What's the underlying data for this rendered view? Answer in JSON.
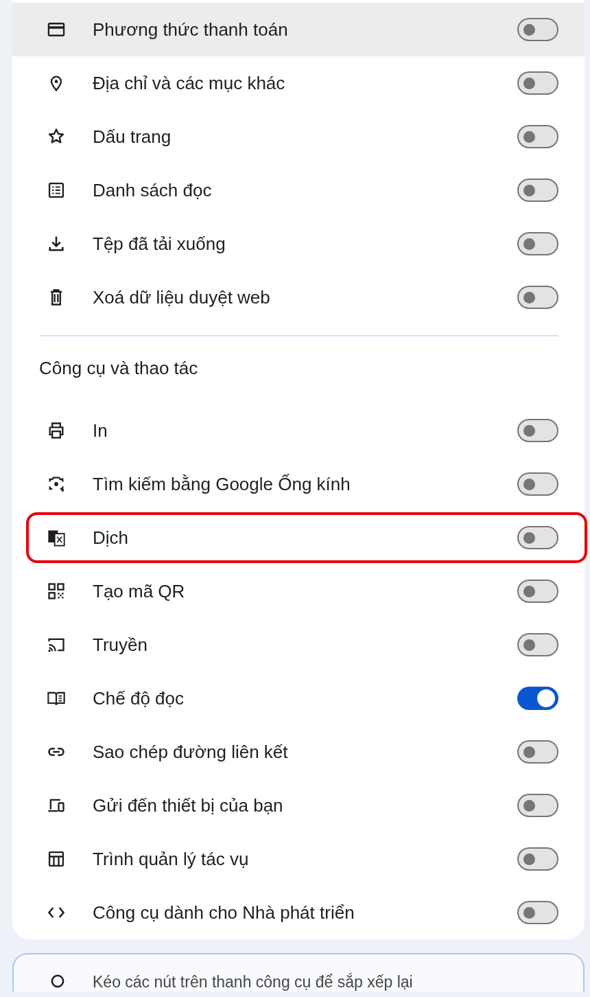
{
  "sections": [
    {
      "items": [
        {
          "label": "Phương thức thanh toán",
          "on": false,
          "hovered": true,
          "highlighted": false
        },
        {
          "label": "Địa chỉ và các mục khác",
          "on": false,
          "hovered": false,
          "highlighted": false
        },
        {
          "label": "Dấu trang",
          "on": false,
          "hovered": false,
          "highlighted": false
        },
        {
          "label": "Danh sách đọc",
          "on": false,
          "hovered": false,
          "highlighted": false
        },
        {
          "label": "Tệp đã tải xuống",
          "on": false,
          "hovered": false,
          "highlighted": false
        },
        {
          "label": "Xoá dữ liệu duyệt web",
          "on": false,
          "hovered": false,
          "highlighted": false
        }
      ]
    },
    {
      "header": "Công cụ và thao tác",
      "items": [
        {
          "label": "In",
          "on": false,
          "hovered": false,
          "highlighted": false
        },
        {
          "label": "Tìm kiếm bằng Google Ống kính",
          "on": false,
          "hovered": false,
          "highlighted": false
        },
        {
          "label": "Dịch",
          "on": false,
          "hovered": false,
          "highlighted": true
        },
        {
          "label": "Tạo mã QR",
          "on": false,
          "hovered": false,
          "highlighted": false
        },
        {
          "label": "Truyền",
          "on": false,
          "hovered": false,
          "highlighted": false
        },
        {
          "label": "Chế độ đọc",
          "on": true,
          "hovered": false,
          "highlighted": false
        },
        {
          "label": "Sao chép đường liên kết",
          "on": false,
          "hovered": false,
          "highlighted": false
        },
        {
          "label": "Gửi đến thiết bị của bạn",
          "on": false,
          "hovered": false,
          "highlighted": false
        },
        {
          "label": "Trình quản lý tác vụ",
          "on": false,
          "hovered": false,
          "highlighted": false
        },
        {
          "label": "Công cụ dành cho Nhà phát triển",
          "on": false,
          "hovered": false,
          "highlighted": false
        }
      ]
    }
  ],
  "hint": {
    "text": "Kéo các nút trên thanh công cụ để sắp xếp lại"
  }
}
